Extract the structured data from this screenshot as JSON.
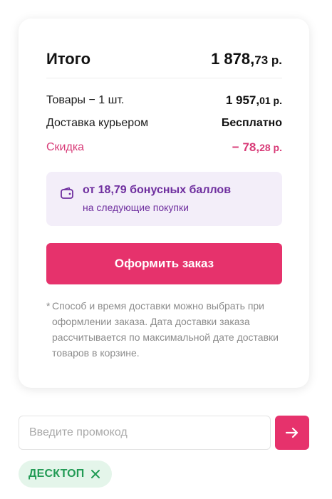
{
  "summary": {
    "total_label": "Итого",
    "total_main": "1 878,",
    "total_frac": "73 р.",
    "goods_label": "Товары − 1 шт.",
    "goods_main": "1 957,",
    "goods_frac": "01 р.",
    "delivery_label": "Доставка курьером",
    "delivery_value": "Бесплатно",
    "discount_label": "Скидка",
    "discount_main": "− 78,",
    "discount_frac": "28 р."
  },
  "bonus": {
    "title": "от 18,79 бонусных баллов",
    "subtitle": "на следующие покупки",
    "icon": "wallet-icon"
  },
  "checkout": {
    "label": "Оформить заказ"
  },
  "note": {
    "star": "*",
    "text": "Способ и время доставки можно выбрать при оформлении заказа. Дата доставки заказа рассчитывается по максимальной дате доставки товаров в корзине."
  },
  "promo": {
    "placeholder": "Введите промокод",
    "submit_icon": "arrow-right-icon"
  },
  "applied_code": {
    "label": "ДЕСКТОП",
    "remove_icon": "close-icon"
  },
  "colors": {
    "accent": "#e6326c",
    "discount": "#d83a77",
    "bonus_bg": "#f3eef9",
    "bonus_text": "#6f2f9f",
    "chip_bg": "#e4f5ea",
    "chip_text": "#229b55"
  }
}
